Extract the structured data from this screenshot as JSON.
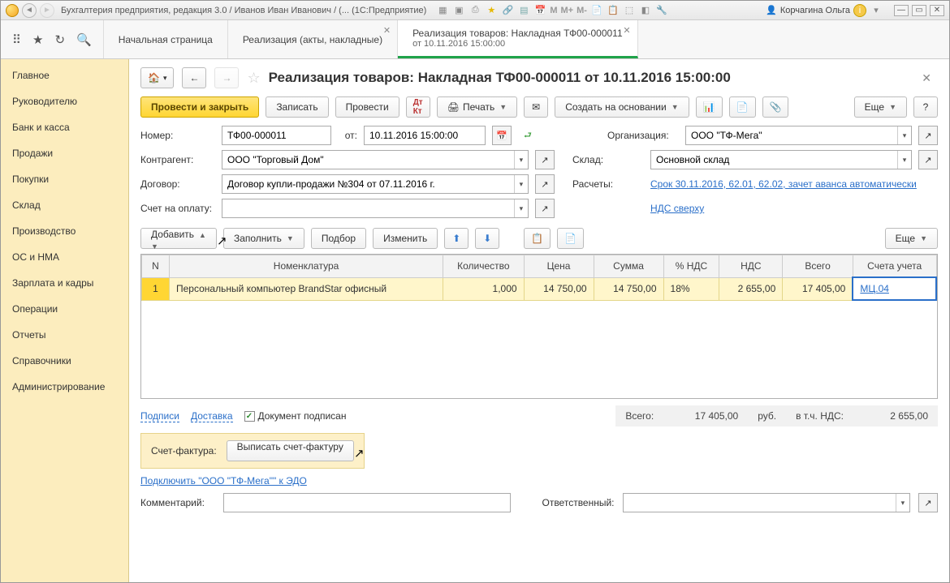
{
  "titlebar": {
    "title": "Бухгалтерия предприятия, редакция 3.0 / Иванов Иван Иванович / (...   (1С:Предприятие)",
    "user": "Корчагина Ольга",
    "m_icons": [
      "М",
      "М+",
      "М-"
    ]
  },
  "tabs": [
    {
      "line1": "Начальная страница",
      "line2": "",
      "closable": false
    },
    {
      "line1": "Реализация (акты, накладные)",
      "line2": "",
      "closable": true
    },
    {
      "line1": "Реализация товаров: Накладная ТФ00-000011",
      "line2": "от 10.11.2016 15:00:00",
      "closable": true,
      "active": true
    }
  ],
  "sidebar": [
    "Главное",
    "Руководителю",
    "Банк и касса",
    "Продажи",
    "Покупки",
    "Склад",
    "Производство",
    "ОС и НМА",
    "Зарплата и кадры",
    "Операции",
    "Отчеты",
    "Справочники",
    "Администрирование"
  ],
  "doc": {
    "title": "Реализация товаров: Накладная ТФ00-000011 от 10.11.2016 15:00:00"
  },
  "cmd": {
    "post_close": "Провести и закрыть",
    "write": "Записать",
    "post": "Провести",
    "print": "Печать",
    "create_based": "Создать на основании",
    "more": "Еще"
  },
  "fields": {
    "number_lbl": "Номер:",
    "number": "ТФ00-000011",
    "from_lbl": "от:",
    "date": "10.11.2016 15:00:00",
    "org_lbl": "Организация:",
    "org": "ООО \"ТФ-Мега\"",
    "contr_lbl": "Контрагент:",
    "contr": "ООО \"Торговый Дом\"",
    "wh_lbl": "Склад:",
    "wh": "Основной склад",
    "dogovor_lbl": "Договор:",
    "dogovor": "Договор купли-продажи №304 от 07.11.2016 г.",
    "calc_lbl": "Расчеты:",
    "calc_link": "Срок 30.11.2016, 62.01, 62.02, зачет аванса автоматически",
    "invoice_lbl": "Счет на оплату:",
    "nds_link": "НДС сверху"
  },
  "tbl_cmd": {
    "add": "Добавить",
    "fill": "Заполнить",
    "select": "Подбор",
    "change": "Изменить",
    "more": "Еще"
  },
  "table": {
    "headers": [
      "N",
      "Номенклатура",
      "Количество",
      "Цена",
      "Сумма",
      "% НДС",
      "НДС",
      "Всего",
      "Счета учета"
    ],
    "rows": [
      {
        "n": "1",
        "nom": "Персональный компьютер BrandStar офисный",
        "qty": "1,000",
        "price": "14 750,00",
        "sum": "14 750,00",
        "nds_pct": "18%",
        "nds": "2 655,00",
        "total": "17 405,00",
        "acct": "МЦ.04"
      }
    ]
  },
  "footer": {
    "signs": "Подписи",
    "delivery": "Доставка",
    "signed": "Документ подписан",
    "total_lbl": "Всего:",
    "total": "17 405,00",
    "rub": "руб.",
    "vat_lbl": "в т.ч. НДС:",
    "vat": "2 655,00",
    "sf_lbl": "Счет-фактура:",
    "sf_btn": "Выписать счет-фактуру",
    "edo_link": "Подключить \"ООО \"ТФ-Мега\"\" к ЭДО",
    "comment_lbl": "Комментарий:",
    "resp_lbl": "Ответственный:"
  }
}
